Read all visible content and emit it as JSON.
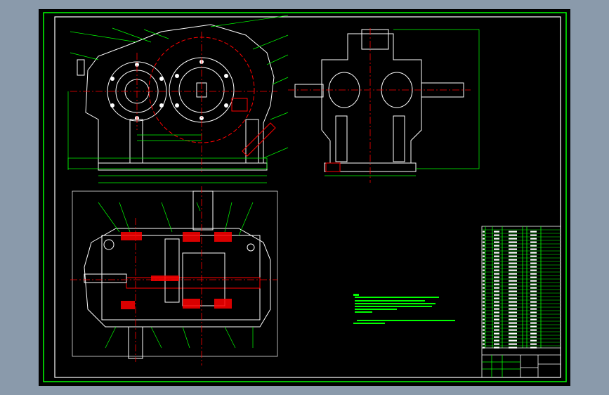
{
  "colors": {
    "viewer_background": "#8a9aab",
    "sheet_background": "#000000",
    "frame_outer": "#00ff00",
    "frame_inner": "#ffffff",
    "geometry": "#ffffff",
    "centerline": "#ff0000",
    "dimension": "#00ff00",
    "hatch": "#ff0000"
  }
}
